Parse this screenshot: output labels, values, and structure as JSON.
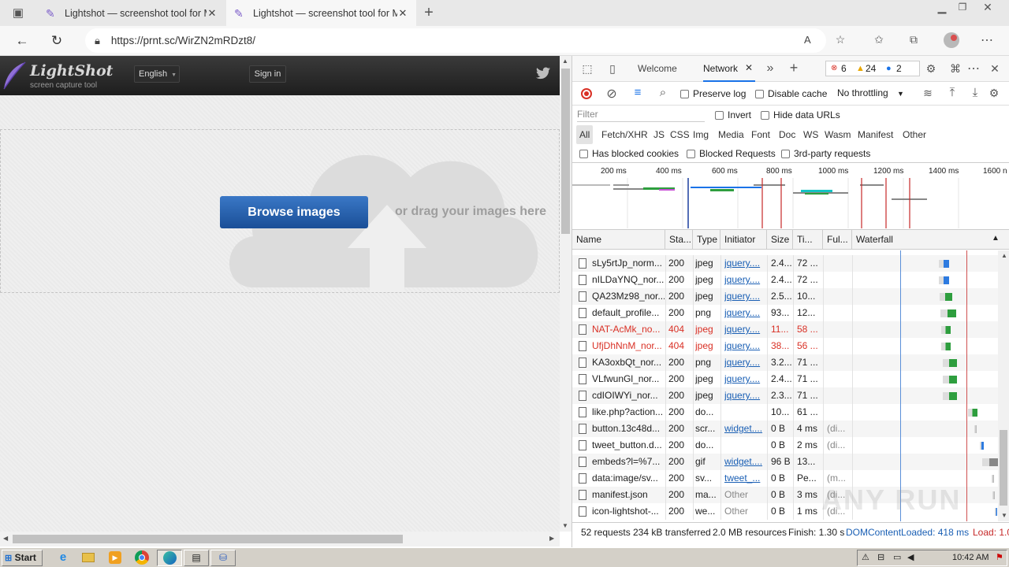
{
  "browser": {
    "tabs": [
      {
        "title": "Lightshot — screenshot tool for M"
      },
      {
        "title": "Lightshot — screenshot tool for M"
      }
    ],
    "url": "https://prnt.sc/WirZN2mRDzt8/"
  },
  "lightshot": {
    "logo": "LightShot",
    "tagline": "screen capture tool",
    "language": "English",
    "signin": "Sign in",
    "browse_label": "Browse images",
    "drag_text": "or drag your images here"
  },
  "devtools": {
    "tabs": {
      "welcome": "Welcome",
      "network": "Network"
    },
    "badges": {
      "errors": "6",
      "warnings": "24",
      "info": "2"
    },
    "toolbar": {
      "preserve_log": "Preserve log",
      "disable_cache": "Disable cache",
      "throttling": "No throttling"
    },
    "filter": {
      "placeholder": "Filter",
      "invert": "Invert",
      "hide_data_urls": "Hide data URLs"
    },
    "types": [
      "All",
      "Fetch/XHR",
      "JS",
      "CSS",
      "Img",
      "Media",
      "Font",
      "Doc",
      "WS",
      "Wasm",
      "Manifest",
      "Other"
    ],
    "blocked": {
      "cookies": "Has blocked cookies",
      "requests": "Blocked Requests",
      "third_party": "3rd-party requests"
    },
    "timeline_ticks": [
      "200 ms",
      "400 ms",
      "600 ms",
      "800 ms",
      "1000 ms",
      "1200 ms",
      "1400 ms",
      "1600 n"
    ],
    "columns": {
      "name": "Name",
      "status": "Sta...",
      "type": "Type",
      "initiator": "Initiator",
      "size": "Size",
      "time": "Ti...",
      "fulfilled": "Ful...",
      "waterfall": "Waterfall"
    },
    "rows": [
      {
        "name": "sLy5rtJp_norm...",
        "status": "200",
        "type": "jpeg",
        "initiator": "jquery....",
        "size": "2.4...",
        "time": "72 ...",
        "fulfilled": "",
        "link": true,
        "error": false
      },
      {
        "name": "nILDaYNQ_nor...",
        "status": "200",
        "type": "jpeg",
        "initiator": "jquery....",
        "size": "2.4...",
        "time": "72 ...",
        "fulfilled": "",
        "link": true,
        "error": false
      },
      {
        "name": "QA23Mz98_nor...",
        "status": "200",
        "type": "jpeg",
        "initiator": "jquery....",
        "size": "2.5...",
        "time": "10...",
        "fulfilled": "",
        "link": true,
        "error": false
      },
      {
        "name": "default_profile...",
        "status": "200",
        "type": "png",
        "initiator": "jquery....",
        "size": "93...",
        "time": "12...",
        "fulfilled": "",
        "link": true,
        "error": false
      },
      {
        "name": "NAT-AcMk_no...",
        "status": "404",
        "type": "jpeg",
        "initiator": "jquery....",
        "size": "11...",
        "time": "58 ...",
        "fulfilled": "",
        "link": true,
        "error": true
      },
      {
        "name": "UfjDhNnM_nor...",
        "status": "404",
        "type": "jpeg",
        "initiator": "jquery....",
        "size": "38...",
        "time": "56 ...",
        "fulfilled": "",
        "link": true,
        "error": true
      },
      {
        "name": "KA3oxbQt_nor...",
        "status": "200",
        "type": "png",
        "initiator": "jquery....",
        "size": "3.2...",
        "time": "71 ...",
        "fulfilled": "",
        "link": true,
        "error": false
      },
      {
        "name": "VLfwunGl_nor...",
        "status": "200",
        "type": "jpeg",
        "initiator": "jquery....",
        "size": "2.4...",
        "time": "71 ...",
        "fulfilled": "",
        "link": true,
        "error": false
      },
      {
        "name": "cdIOIWYi_nor...",
        "status": "200",
        "type": "jpeg",
        "initiator": "jquery....",
        "size": "2.3...",
        "time": "71 ...",
        "fulfilled": "",
        "link": true,
        "error": false
      },
      {
        "name": "like.php?action...",
        "status": "200",
        "type": "do...",
        "initiator": "",
        "size": "10...",
        "time": "61 ...",
        "fulfilled": "",
        "link": false,
        "error": false
      },
      {
        "name": "button.13c48d...",
        "status": "200",
        "type": "scr...",
        "initiator": "widget....",
        "size": "0 B",
        "time": "4 ms",
        "fulfilled": "(di...",
        "link": true,
        "error": false
      },
      {
        "name": "tweet_button.d...",
        "status": "200",
        "type": "do...",
        "initiator": "",
        "size": "0 B",
        "time": "2 ms",
        "fulfilled": "(di...",
        "link": false,
        "error": false
      },
      {
        "name": "embeds?l=%7...",
        "status": "200",
        "type": "gif",
        "initiator": "widget....",
        "size": "96 B",
        "time": "13...",
        "fulfilled": "",
        "link": true,
        "error": false
      },
      {
        "name": "data:image/sv...",
        "status": "200",
        "type": "sv...",
        "initiator": "tweet_...",
        "size": "0 B",
        "time": "Pe...",
        "fulfilled": "(m...",
        "link": true,
        "error": false
      },
      {
        "name": "manifest.json",
        "status": "200",
        "type": "ma...",
        "initiator": "Other",
        "size": "0 B",
        "time": "3 ms",
        "fulfilled": "(di...",
        "link": false,
        "error": false
      },
      {
        "name": "icon-lightshot-...",
        "status": "200",
        "type": "we...",
        "initiator": "Other",
        "size": "0 B",
        "time": "1 ms",
        "fulfilled": "(di...",
        "link": false,
        "error": false
      }
    ],
    "status": {
      "requests": "52 requests",
      "transferred": "234 kB transferred",
      "resources": "2.0 MB resources",
      "finish": "Finish: 1.30 s",
      "dcl": "DOMContentLoaded: 418 ms",
      "load": "Load: 1.0"
    }
  },
  "watermark": "ANY RUN",
  "taskbar": {
    "start": "Start",
    "clock": "10:42 AM"
  }
}
